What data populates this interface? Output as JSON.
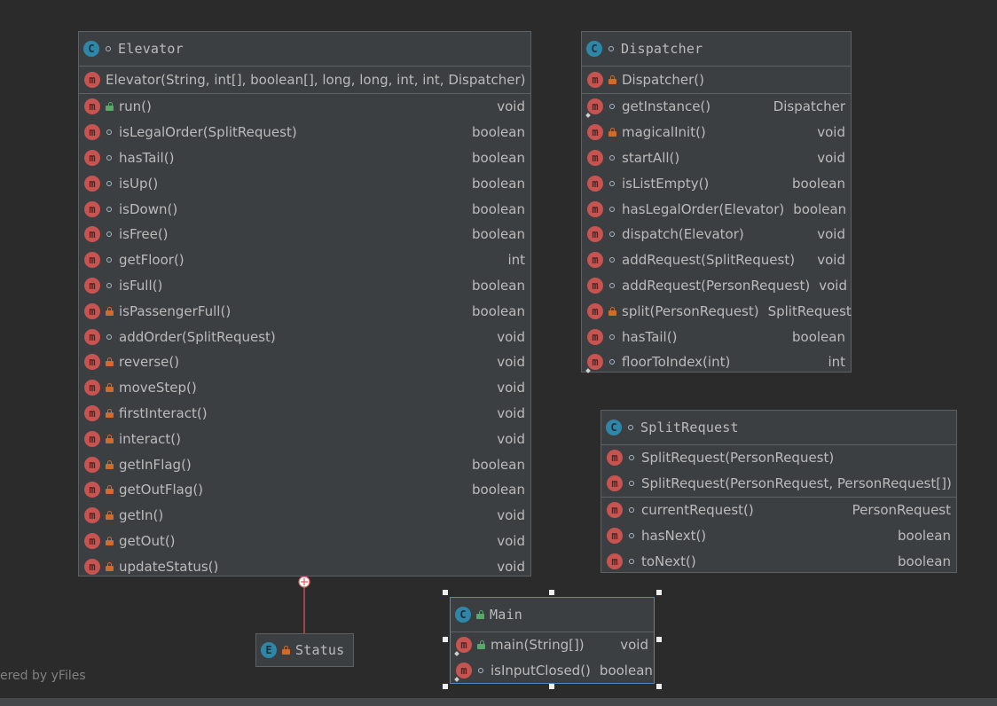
{
  "watermark": "ered by yFiles",
  "colors": {
    "background": "#2b2b2b",
    "node_fill": "#3c3f41",
    "node_border": "#5e6163",
    "selected_border": "#4a88c7",
    "class_icon": "#2e87a8",
    "method_icon": "#c75450",
    "private_lock": "#d16a2d",
    "public_unlock": "#59a869",
    "inner_edge": "#e05a5a"
  },
  "icons": {
    "class": "C",
    "enum": "E",
    "method": "m"
  },
  "elevator": {
    "name": "Elevator",
    "constructor": "Elevator(String, int[], boolean[], long, long, int, int, Dispatcher)",
    "methods": [
      {
        "name": "run()",
        "type": "void",
        "vis": "public"
      },
      {
        "name": "isLegalOrder(SplitRequest)",
        "type": "boolean",
        "vis": "package"
      },
      {
        "name": "hasTail()",
        "type": "boolean",
        "vis": "package"
      },
      {
        "name": "isUp()",
        "type": "boolean",
        "vis": "package"
      },
      {
        "name": "isDown()",
        "type": "boolean",
        "vis": "package"
      },
      {
        "name": "isFree()",
        "type": "boolean",
        "vis": "package"
      },
      {
        "name": "getFloor()",
        "type": "int",
        "vis": "package"
      },
      {
        "name": "isFull()",
        "type": "boolean",
        "vis": "package"
      },
      {
        "name": "isPassengerFull()",
        "type": "boolean",
        "vis": "private"
      },
      {
        "name": "addOrder(SplitRequest)",
        "type": "void",
        "vis": "package"
      },
      {
        "name": "reverse()",
        "type": "void",
        "vis": "private"
      },
      {
        "name": "moveStep()",
        "type": "void",
        "vis": "private"
      },
      {
        "name": "firstInteract()",
        "type": "void",
        "vis": "private"
      },
      {
        "name": "interact()",
        "type": "void",
        "vis": "private"
      },
      {
        "name": "getInFlag()",
        "type": "boolean",
        "vis": "private"
      },
      {
        "name": "getOutFlag()",
        "type": "boolean",
        "vis": "private"
      },
      {
        "name": "getIn()",
        "type": "void",
        "vis": "private"
      },
      {
        "name": "getOut()",
        "type": "void",
        "vis": "private"
      },
      {
        "name": "updateStatus()",
        "type": "void",
        "vis": "private"
      }
    ]
  },
  "dispatcher": {
    "name": "Dispatcher",
    "constructor": "Dispatcher()",
    "methods": [
      {
        "name": "getInstance()",
        "type": "Dispatcher",
        "vis": "package",
        "static": true
      },
      {
        "name": "magicalInit()",
        "type": "void",
        "vis": "private"
      },
      {
        "name": "startAll()",
        "type": "void",
        "vis": "package"
      },
      {
        "name": "isListEmpty()",
        "type": "boolean",
        "vis": "package"
      },
      {
        "name": "hasLegalOrder(Elevator)",
        "type": "boolean",
        "vis": "package"
      },
      {
        "name": "dispatch(Elevator)",
        "type": "void",
        "vis": "package"
      },
      {
        "name": "addRequest(SplitRequest)",
        "type": "void",
        "vis": "package"
      },
      {
        "name": "addRequest(PersonRequest)",
        "type": "void",
        "vis": "package"
      },
      {
        "name": "split(PersonRequest)",
        "type": "SplitRequest",
        "vis": "private"
      },
      {
        "name": "hasTail()",
        "type": "boolean",
        "vis": "package"
      },
      {
        "name": "floorToIndex(int)",
        "type": "int",
        "vis": "package",
        "static": true
      }
    ]
  },
  "split_request": {
    "name": "SplitRequest",
    "constructors": [
      "SplitRequest(PersonRequest)",
      "SplitRequest(PersonRequest, PersonRequest[])"
    ],
    "methods": [
      {
        "name": "currentRequest()",
        "type": "PersonRequest",
        "vis": "package"
      },
      {
        "name": "hasNext()",
        "type": "boolean",
        "vis": "package"
      },
      {
        "name": "toNext()",
        "type": "boolean",
        "vis": "package"
      }
    ]
  },
  "main": {
    "name": "Main",
    "methods": [
      {
        "name": "main(String[])",
        "type": "void",
        "vis": "public",
        "static": true
      },
      {
        "name": "isInputClosed()",
        "type": "boolean",
        "vis": "package",
        "static": true
      }
    ]
  },
  "status": {
    "name": "Status"
  }
}
